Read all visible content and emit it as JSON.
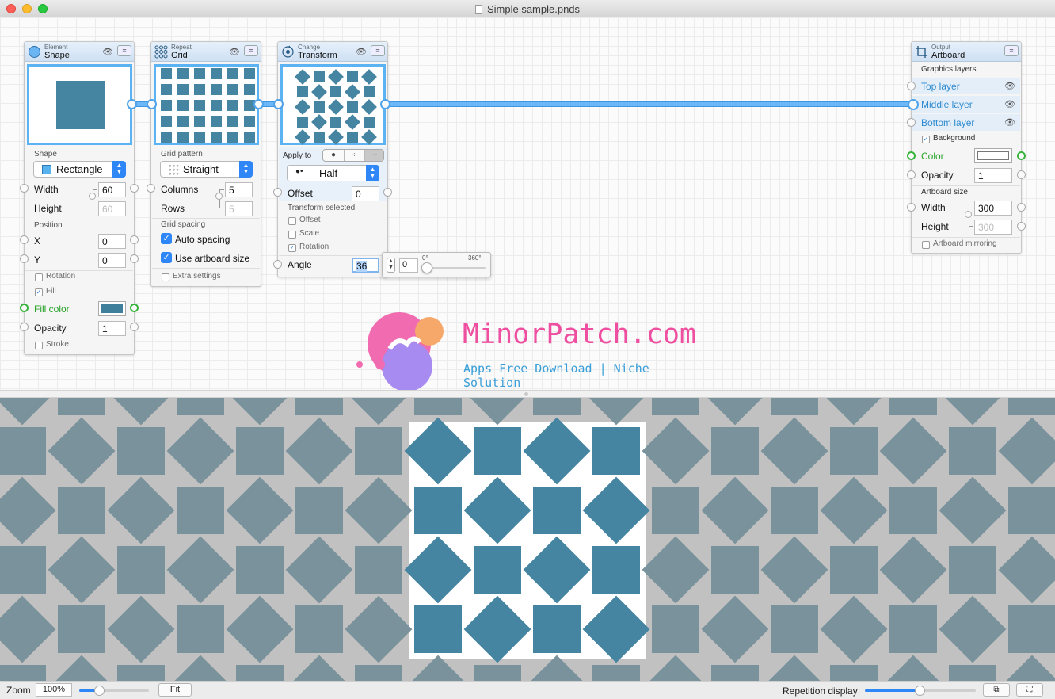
{
  "window": {
    "title": "Simple sample.pnds"
  },
  "nodes": {
    "shape": {
      "category": "Element",
      "name": "Shape",
      "shape_label": "Shape",
      "shape_value": "Rectangle",
      "width_label": "Width",
      "width_value": "60",
      "height_label": "Height",
      "height_value": "60",
      "position_label": "Position",
      "x_label": "X",
      "x_value": "0",
      "y_label": "Y",
      "y_value": "0",
      "rotation_label": "Rotation",
      "fill_label": "Fill",
      "fill_color_label": "Fill color",
      "fill_color": "#3f7f9c",
      "opacity_label": "Opacity",
      "opacity_value": "1",
      "stroke_label": "Stroke"
    },
    "grid": {
      "category": "Repeat",
      "name": "Grid",
      "pattern_label": "Grid pattern",
      "pattern_value": "Straight",
      "columns_label": "Columns",
      "columns_value": "5",
      "rows_label": "Rows",
      "rows_value": "5",
      "spacing_label": "Grid spacing",
      "auto_spacing_label": "Auto spacing",
      "artboard_size_label": "Use artboard size",
      "extra_label": "Extra settings"
    },
    "transform": {
      "category": "Change",
      "name": "Transform",
      "apply_label": "Apply to",
      "mode_value": "Half",
      "offset_label": "Offset",
      "offset_value": "0",
      "selected_label": "Transform selected",
      "opt_offset": "Offset",
      "opt_scale": "Scale",
      "opt_rotation": "Rotation",
      "angle_label": "Angle",
      "angle_value": "36"
    },
    "angle_popover": {
      "stepper_value": "0",
      "min_label": "0°",
      "max_label": "360°",
      "slider_fraction": 0.05
    },
    "artboard": {
      "category": "Output",
      "name": "Artboard",
      "layers_label": "Graphics layers",
      "layers": [
        "Top layer",
        "Middle layer",
        "Bottom layer"
      ],
      "background_label": "Background",
      "color_label": "Color",
      "opacity_label": "Opacity",
      "opacity_value": "1",
      "size_label": "Artboard size",
      "width_label": "Width",
      "width_value": "300",
      "height_label": "Height",
      "height_value": "300",
      "mirroring_label": "Artboard mirroring"
    }
  },
  "watermark": {
    "title": "MinorPatch.com",
    "subtitle": "Apps Free Download | Niche Solution"
  },
  "bottom": {
    "zoom_label": "Zoom",
    "zoom_value": "100%",
    "zoom_fraction": 0.3,
    "fit_label": "Fit",
    "repetition_label": "Repetition display",
    "repetition_fraction": 0.5
  },
  "colors": {
    "accent": "#2f86f6",
    "shape": "#4585a2",
    "shape_repeat": "#7a929c",
    "port_green": "#38b43c",
    "wire": "#6cb7f5"
  }
}
